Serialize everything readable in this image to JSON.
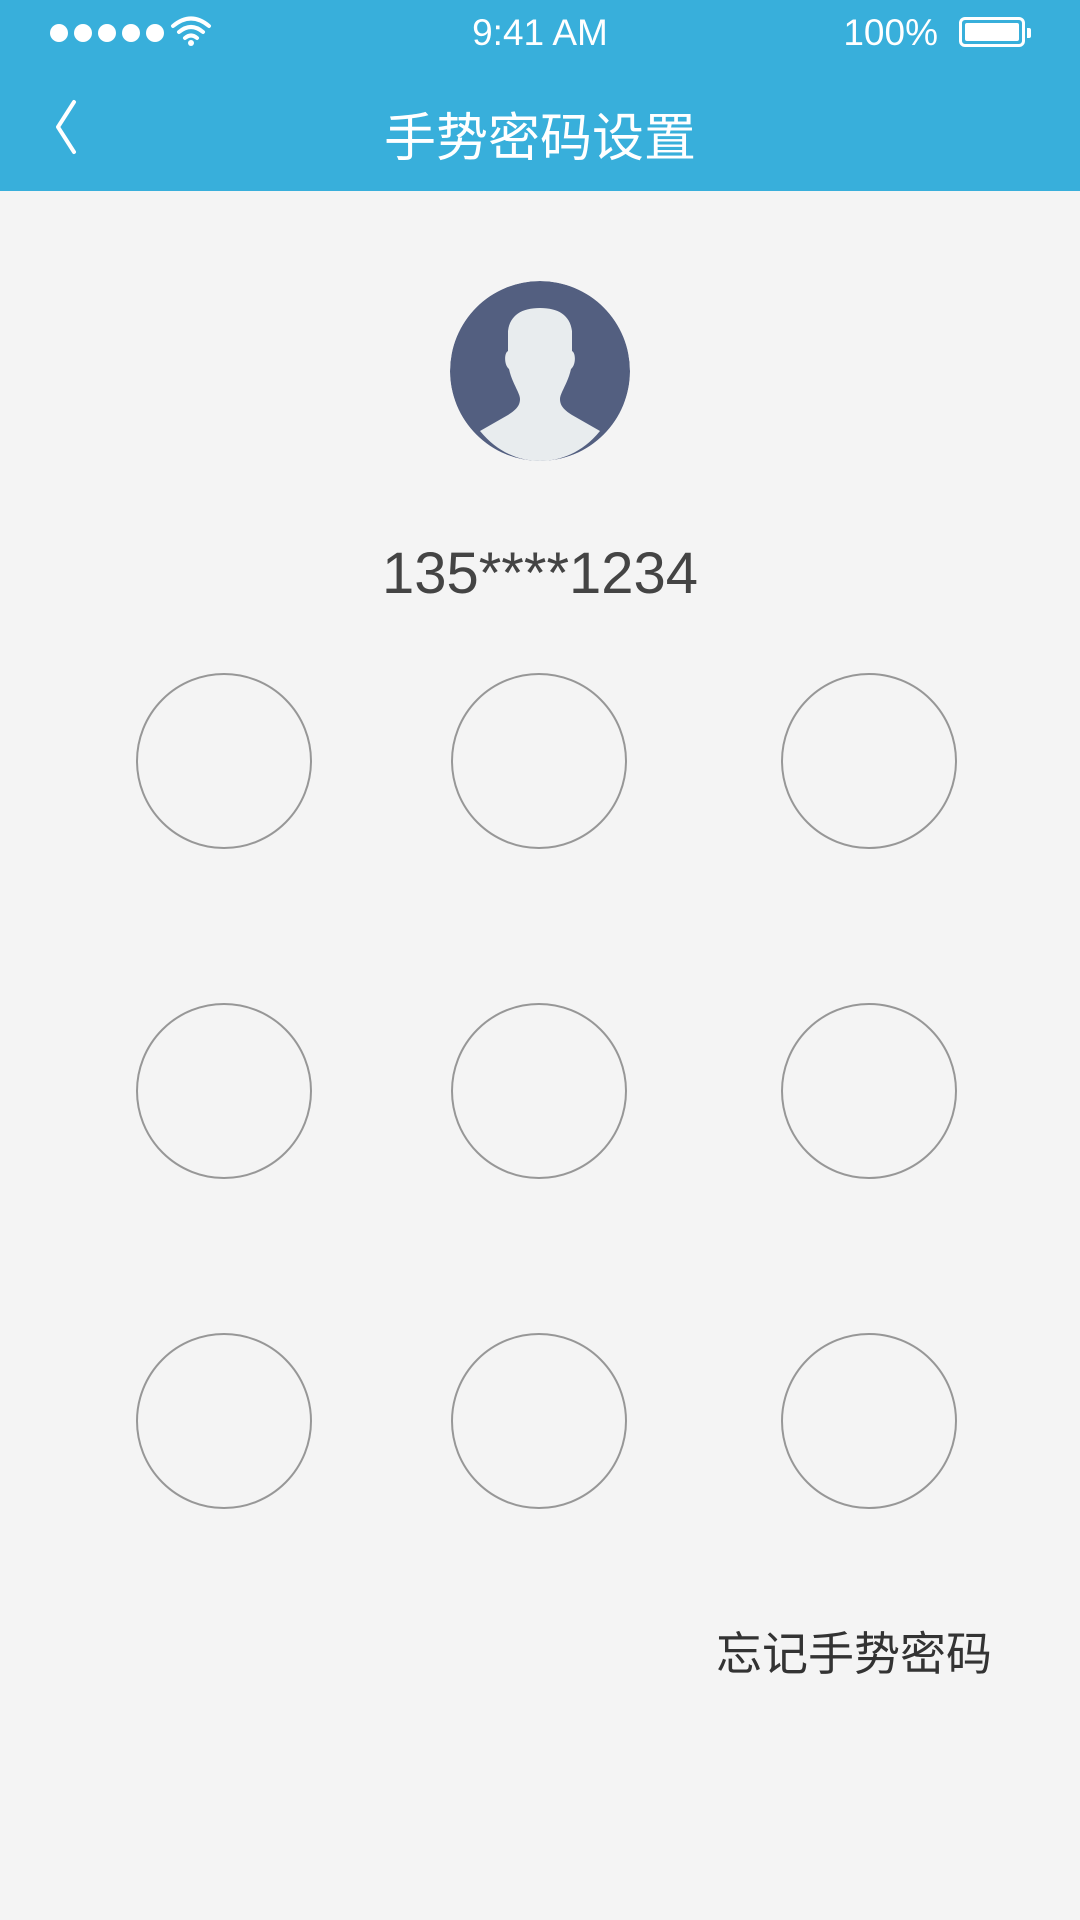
{
  "status_bar": {
    "time": "9:41 AM",
    "battery_percent": "100%",
    "signal_bars": 5,
    "icons": [
      "signal-dots",
      "wifi-icon",
      "battery-icon"
    ]
  },
  "nav": {
    "back_icon": "chevron-left-icon",
    "title": "手势密码设置"
  },
  "profile": {
    "avatar_icon": "user-silhouette-icon",
    "phone": "135****1234"
  },
  "gesture_grid": {
    "rows": 3,
    "cols": 3,
    "points": [
      "1",
      "2",
      "3",
      "4",
      "5",
      "6",
      "7",
      "8",
      "9"
    ]
  },
  "forgot_link": "忘记手势密码",
  "colors": {
    "header": "#38afdb",
    "background": "#f4f4f4",
    "avatar": "#535f80",
    "circle_border": "#979797",
    "text": "#444444"
  }
}
